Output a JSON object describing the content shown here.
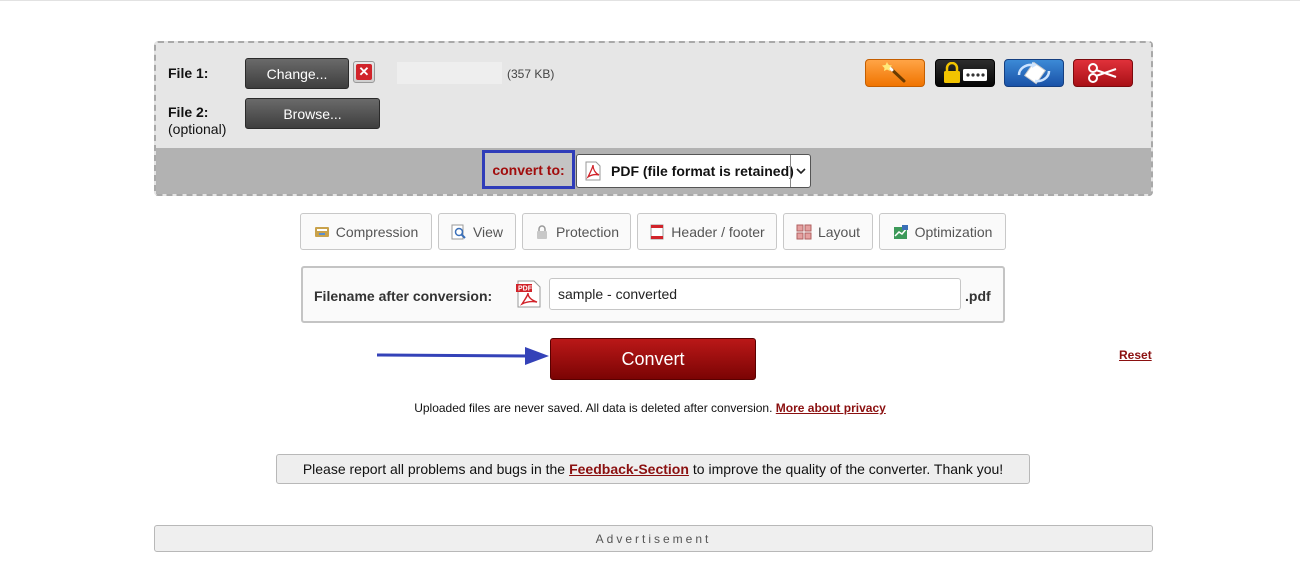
{
  "upload": {
    "file1_label": "File 1:",
    "file1_button": "Change...",
    "file1_size": "(357 KB)",
    "file2_label": "File 2:",
    "file2_sublabel": "(optional)",
    "file2_button": "Browse..."
  },
  "tools": [
    {
      "icon": "magic-wand-icon",
      "color": "#f07400"
    },
    {
      "icon": "password-lock-icon",
      "color": "#050505"
    },
    {
      "icon": "rotate-page-icon",
      "color": "#1a52a8"
    },
    {
      "icon": "scissors-icon",
      "color": "#a81016"
    }
  ],
  "convert_to": {
    "label": "convert to:",
    "selected": "PDF (file format is retained)"
  },
  "tabs": [
    {
      "label": "Compression",
      "icon": "compression-icon"
    },
    {
      "label": "View",
      "icon": "view-icon"
    },
    {
      "label": "Protection",
      "icon": "protection-icon"
    },
    {
      "label": "Header / footer",
      "icon": "header-footer-icon"
    },
    {
      "label": "Layout",
      "icon": "layout-icon"
    },
    {
      "label": "Optimization",
      "icon": "optimization-icon"
    }
  ],
  "filename": {
    "label": "Filename after conversion:",
    "value": "sample - converted",
    "extension": ".pdf"
  },
  "actions": {
    "convert": "Convert",
    "reset": "Reset"
  },
  "privacy": {
    "text": "Uploaded files are never saved. All data is deleted after conversion.",
    "link": "More about privacy"
  },
  "feedback": {
    "before": "Please report all problems and bugs in the",
    "link": "Feedback-Section",
    "after": "to improve the quality of the converter. Thank you!"
  },
  "advertisement": "Advertisement",
  "colors": {
    "accent_red": "#8b1010",
    "highlight_blue": "#2f3cb9"
  }
}
